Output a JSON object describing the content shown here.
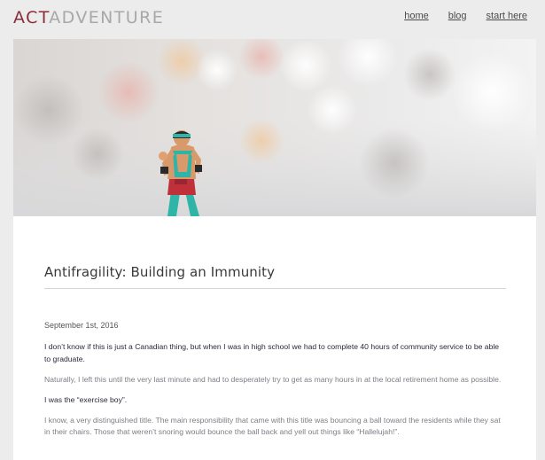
{
  "header": {
    "logo_part1": "ACT",
    "logo_part2": "ADVENTURE",
    "nav": [
      {
        "label": "home"
      },
      {
        "label": "blog"
      },
      {
        "label": "start here"
      }
    ]
  },
  "post": {
    "title": "Antifragility: Building an Immunity",
    "date": "September 1st, 2016",
    "paragraphs": [
      "I don’t know if this is just a Canadian thing, but when I was in high school we had to complete 40 hours of community service to be able to graduate.",
      "Naturally, I left this until the very last minute and had to desperately try to get as many hours in at the local retirement home as possible.",
      "I was the “exercise boy”.",
      "I know, a very distinguished title. The main responsibility that came with this title was bouncing a ball toward the residents while they sat in their chairs. Those that weren’t snoring would bounce the ball back and yell out things like “Hallelujah!”."
    ]
  },
  "colors": {
    "logo_accent": "#8a2d3a",
    "logo_muted": "#a8a8a8",
    "figure_teal": "#2fb5a8"
  }
}
